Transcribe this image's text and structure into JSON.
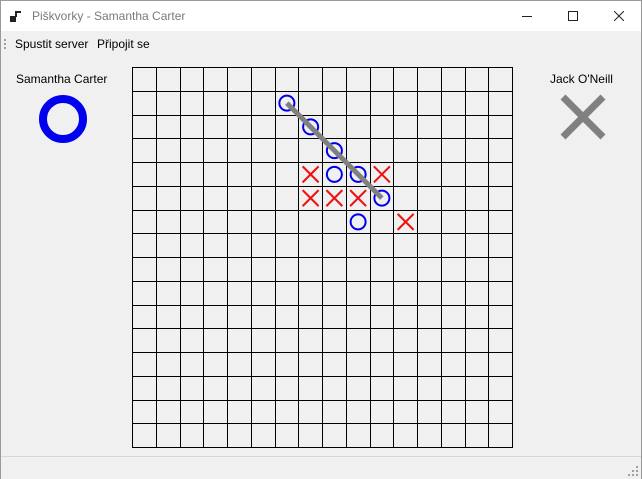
{
  "window": {
    "title": "Piškvorky - Samantha Carter",
    "buttons": {
      "minimize": "minimize-icon",
      "maximize": "maximize-icon",
      "close": "close-icon"
    }
  },
  "menu": {
    "items": [
      {
        "label": "Spustit server"
      },
      {
        "label": "Připojit se"
      }
    ]
  },
  "players": {
    "left": {
      "name": "Samantha Carter",
      "symbol": "circle",
      "color": "#0000ee"
    },
    "right": {
      "name": "Jack O'Neill",
      "symbol": "cross",
      "color": "#808080"
    }
  },
  "board": {
    "cols": 16,
    "rows": 16,
    "circle_color": "#0000ee",
    "cross_color": "#ee1111",
    "win_line_color": "#808080",
    "circles": [
      [
        6,
        1
      ],
      [
        7,
        2
      ],
      [
        8,
        3
      ],
      [
        8,
        4
      ],
      [
        9,
        4
      ],
      [
        10,
        5
      ],
      [
        9,
        6
      ]
    ],
    "crosses": [
      [
        7,
        4
      ],
      [
        10,
        4
      ],
      [
        7,
        5
      ],
      [
        8,
        5
      ],
      [
        9,
        5
      ],
      [
        11,
        6
      ]
    ],
    "win_line": {
      "from": [
        6,
        1
      ],
      "to": [
        10,
        5
      ]
    }
  }
}
